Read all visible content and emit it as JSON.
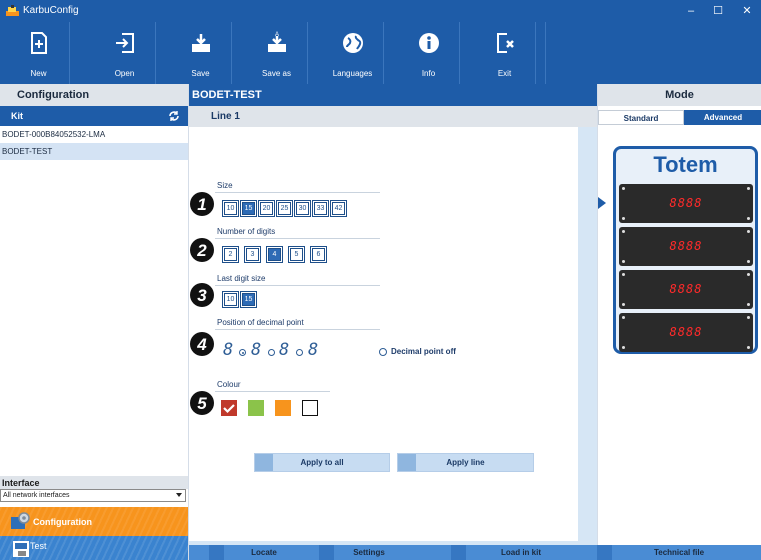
{
  "window": {
    "title": "KarbuConfig",
    "minimize": "–",
    "maximize": "☐",
    "close": "✕"
  },
  "toolbar": [
    {
      "label": "New",
      "icon": "new-file-icon"
    },
    {
      "label": "Open",
      "icon": "open-icon"
    },
    {
      "label": "Save",
      "icon": "save-icon"
    },
    {
      "label": "Save as",
      "icon": "save-as-icon"
    },
    {
      "label": "Languages",
      "icon": "globe-icon"
    },
    {
      "label": "Info",
      "icon": "info-icon"
    },
    {
      "label": "Exit",
      "icon": "exit-icon"
    }
  ],
  "configuration": {
    "title": "Configuration",
    "kit_header": "Kit",
    "kits": [
      {
        "label": "BODET-000B84052532-LMA",
        "selected": false
      },
      {
        "label": "BODET-TEST",
        "selected": true
      }
    ],
    "interface_header": "Interface",
    "interface_value": "All network interfaces",
    "nav_configuration": "Configuration",
    "nav_test": "Test"
  },
  "center": {
    "kit_title": "BODET-TEST",
    "line_title": "Line 1",
    "size": {
      "title": "Size",
      "options": [
        "10",
        "15",
        "20",
        "25",
        "30",
        "33",
        "42"
      ],
      "selected": "15"
    },
    "digits": {
      "title": "Number of digits",
      "options": [
        "2",
        "3",
        "4",
        "5",
        "6"
      ],
      "selected": "4"
    },
    "last_digit": {
      "title": "Last digit size",
      "options": [
        "10",
        "15"
      ],
      "selected": "15"
    },
    "decimal": {
      "title": "Position of decimal point",
      "digit_glyph": "8",
      "off_label": "Decimal point off",
      "selected_index": 0
    },
    "colour": {
      "title": "Colour",
      "swatches": [
        "#c0392b",
        "#8bc34a",
        "#f7941d",
        "#ffffff"
      ],
      "selected_index": 0
    },
    "step_numbers": [
      "1",
      "2",
      "3",
      "4",
      "5"
    ],
    "apply_all": "Apply to all",
    "apply_line": "Apply line"
  },
  "bottom": {
    "locate": "Locate",
    "settings": "Settings",
    "load_in_kit": "Load in kit",
    "technical_file": "Technical file"
  },
  "mode": {
    "title": "Mode",
    "standard": "Standard",
    "advanced": "Advanced",
    "active": "Advanced",
    "totem_title": "Totem",
    "displays": [
      "8888",
      "8888",
      "8888",
      "8888"
    ]
  }
}
